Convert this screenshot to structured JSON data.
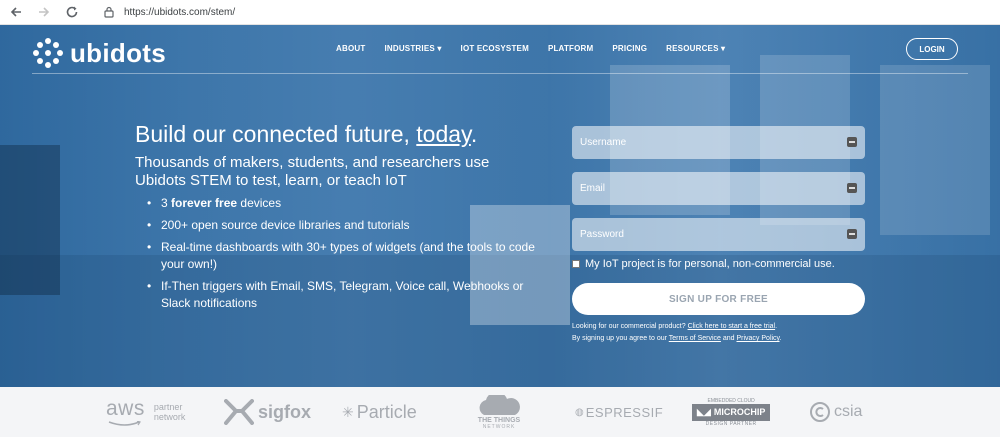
{
  "browser": {
    "url": "https://ubidots.com/stem/"
  },
  "header": {
    "logo_text": "ubidots",
    "nav": [
      "ABOUT",
      "INDUSTRIES",
      "IOT ECOSYSTEM",
      "PLATFORM",
      "PRICING",
      "RESOURCES"
    ],
    "login_label": "LOGIN"
  },
  "hero": {
    "headline_pre": "Build our connected future, ",
    "headline_link": "today",
    "headline_post": ".",
    "subhead": "Thousands of makers, students, and researchers use Ubidots STEM to test, learn, or teach IoT",
    "bullets": [
      {
        "pre": "3 ",
        "bold": "forever free",
        "post": " devices"
      },
      {
        "text": "200+ open source device libraries and tutorials"
      },
      {
        "text": "Real-time dashboards with 30+ types of widgets (and the tools to code your own!)"
      },
      {
        "text": "If-Then triggers with Email, SMS, Telegram, Voice call, Webhooks or Slack notifications"
      }
    ]
  },
  "form": {
    "username_placeholder": "Username",
    "email_placeholder": "Email",
    "password_placeholder": "Password",
    "consent_label": "My IoT project is for personal, non-commercial use.",
    "signup_label": "SIGN UP FOR FREE",
    "commercial_pre": "Looking for our commercial product? ",
    "commercial_link": "Click here to start a free trial",
    "commercial_post": ".",
    "terms_pre": "By signing up you agree to our ",
    "terms_link": "Terms of Service",
    "terms_mid": " and ",
    "privacy_link": "Privacy Policy",
    "terms_post": "."
  },
  "partners": {
    "aws": "aws",
    "aws_sub1": "partner",
    "aws_sub2": "network",
    "sigfox": "sigfox",
    "particle": "Particle",
    "ttn1": "THE THINGS",
    "ttn2": "NETWORK",
    "espressif": "ESPRESSIF",
    "microchip_top": "EMBEDDED CLOUD",
    "microchip": "MICROCHIP",
    "microchip_bottom": "DESIGN PARTNER",
    "csia": "csia"
  },
  "colors": {
    "overlay": "#2a6caa",
    "partner_bg": "#f4f5f7",
    "partner_logo": "#a7abb1"
  }
}
